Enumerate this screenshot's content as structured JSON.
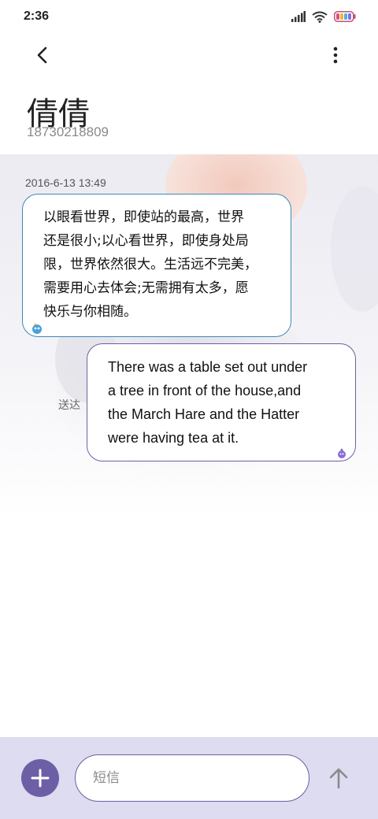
{
  "status_bar": {
    "time": "2:36",
    "icons": [
      "signal-icon",
      "wifi-icon",
      "battery-icon"
    ]
  },
  "top_bar": {
    "back_icon": "back-arrow-icon",
    "more_icon": "more-vertical-icon"
  },
  "contact": {
    "name": "倩倩",
    "number": "18730218809"
  },
  "conversation": {
    "timestamp": "2016-6-13 13:49",
    "messages": [
      {
        "direction": "incoming",
        "lines": [
          "以眼看世界，即使站的最高，世界",
          "还是很小;以心看世界，即使身处局",
          "限，世界依然很大。生活远不完美，",
          "需要用心去体会;无需拥有太多，愿",
          "快乐与你相随。"
        ]
      },
      {
        "direction": "outgoing",
        "status": "送达",
        "lines": [
          "There was a table set out under",
          "a tree in front of the house,and",
          "the March Hare and the Hatter",
          "were having tea at it."
        ]
      }
    ]
  },
  "composer": {
    "placeholder": "短信",
    "value": "",
    "add_icon": "plus-icon",
    "send_icon": "send-arrow-icon"
  },
  "colors": {
    "incoming_border": "#3a8ab8",
    "outgoing_border": "#6b5fa3",
    "accent": "#6d5fa6",
    "composer_bg": "#dddcf0"
  }
}
